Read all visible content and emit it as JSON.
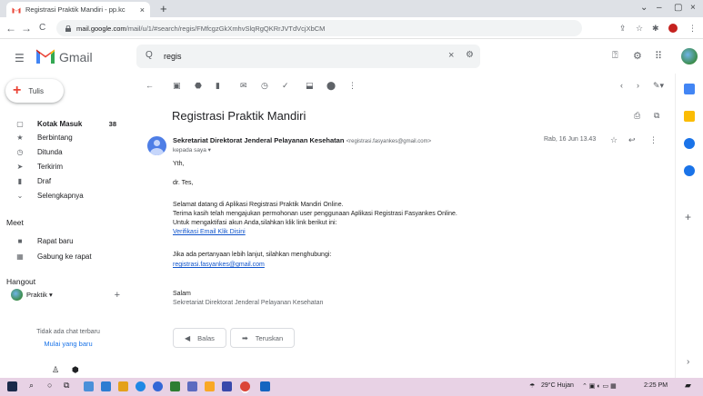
{
  "browser": {
    "tab_title": "Registrasi Praktik Mandiri - pp.kc",
    "tab_close": "×",
    "new_tab": "+",
    "url_host": "mail.google.com",
    "url_path": "/mail/u/1/#search/regis/FMfcgzGkXmhvSlqRgQKRrJVTdVcjXbCM",
    "controls": {
      "minimize": "–",
      "restore": "▢",
      "close": "×",
      "dropdown": "⌄"
    },
    "nav": {
      "back": "←",
      "forward": "→",
      "reload": "C"
    }
  },
  "gmail": {
    "brand": "Gmail",
    "search_value": "regis",
    "search_icon": "Q",
    "clear_icon": "×",
    "filter_icon": "⚙"
  },
  "sidebar": {
    "compose_label": "Tulis",
    "items": [
      {
        "icon": "▢",
        "label": "Kotak Masuk",
        "count": "38"
      },
      {
        "icon": "★",
        "label": "Berbintang",
        "count": ""
      },
      {
        "icon": "◷",
        "label": "Ditunda",
        "count": ""
      },
      {
        "icon": "➤",
        "label": "Terkirim",
        "count": ""
      },
      {
        "icon": "▮",
        "label": "Draf",
        "count": ""
      },
      {
        "icon": "⌄",
        "label": "Selengkapnya",
        "count": ""
      }
    ],
    "meet_title": "Meet",
    "meet_items": [
      {
        "icon": "■",
        "label": "Rapat baru"
      },
      {
        "icon": "▦",
        "label": "Gabung ke rapat"
      }
    ],
    "hangout_title": "Hangout",
    "hangout_user": "Praktik ▾",
    "hangout_add": "+",
    "no_chat": "Tidak ada chat terbaru",
    "start_new": "Mulai yang baru"
  },
  "message": {
    "subject": "Registrasi Praktik Mandiri",
    "sender_name": "Sekretariat Direktorat Jenderal Pelayanan Kesehatan",
    "sender_email": "<registrasi.fasyankes@gmail.com>",
    "to": "kepada saya ▾",
    "date": "Rab, 16 Jun 13.43",
    "greeting": "Yth,",
    "recipient": "dr. Tes,",
    "p1": "Selamat datang di Aplikasi Registrasi Praktik Mandiri Online.",
    "p2": "Terima kasih telah mengajukan permohonan user penggunaan Aplikasi Registrasi Fasyankes Online.",
    "p3": "Untuk mengaktifasi akun Anda,silahkan klik link berikut ini:",
    "verify_link": "Verifikasi Email Klik Disini",
    "p4": "Jika ada pertanyaan lebih lanjut, silahkan menghubungi:",
    "contact_link": "registrasi.fasyankes@gmail.com",
    "closing": "Salam",
    "signature": "Sekretariat Direktorat Jenderal Pelayanan Kesehatan",
    "reply_label": "Balas",
    "forward_label": "Teruskan"
  },
  "taskbar": {
    "weather": "29°C Hujan",
    "time": "2:25 PM"
  },
  "colors": {
    "gmail_red": "#ea4335",
    "link": "#1155cc",
    "taskbar": "#e8d2e5"
  }
}
